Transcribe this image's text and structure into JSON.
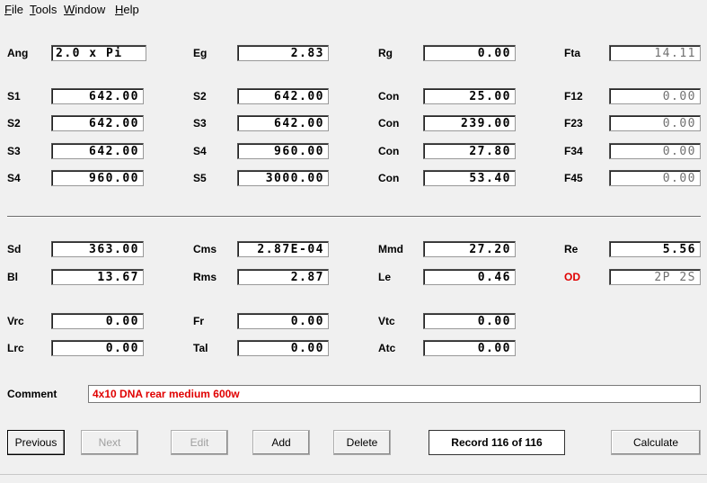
{
  "menu": [
    {
      "pre": "",
      "ul": "F",
      "post": "ile"
    },
    {
      "pre": "",
      "ul": "T",
      "post": "ools"
    },
    {
      "pre": "",
      "ul": "W",
      "post": "indow"
    },
    {
      "pre": "",
      "ul": "H",
      "post": "elp"
    }
  ],
  "params": {
    "ang": {
      "label": "Ang",
      "value": "2.0 x Pi"
    },
    "eg": {
      "label": "Eg",
      "value": "2.83"
    },
    "rg": {
      "label": "Rg",
      "value": "0.00"
    },
    "fta": {
      "label": "Fta",
      "value": "14.11"
    }
  },
  "stages": [
    {
      "a_label": "S1",
      "a": "642.00",
      "b_label": "S2",
      "b": "642.00",
      "c_label": "Con",
      "c": "25.00",
      "f_label": "F12",
      "f": "0.00"
    },
    {
      "a_label": "S2",
      "a": "642.00",
      "b_label": "S3",
      "b": "642.00",
      "c_label": "Con",
      "c": "239.00",
      "f_label": "F23",
      "f": "0.00"
    },
    {
      "a_label": "S3",
      "a": "642.00",
      "b_label": "S4",
      "b": "960.00",
      "c_label": "Con",
      "c": "27.80",
      "f_label": "F34",
      "f": "0.00"
    },
    {
      "a_label": "S4",
      "a": "960.00",
      "b_label": "S5",
      "b": "3000.00",
      "c_label": "Con",
      "c": "53.40",
      "f_label": "F45",
      "f": "0.00"
    }
  ],
  "driver": {
    "sd": {
      "label": "Sd",
      "value": "363.00"
    },
    "cms": {
      "label": "Cms",
      "value": "2.87E-04"
    },
    "mmd": {
      "label": "Mmd",
      "value": "27.20"
    },
    "re": {
      "label": "Re",
      "value": "5.56"
    },
    "bl": {
      "label": "Bl",
      "value": "13.67"
    },
    "rms": {
      "label": "Rms",
      "value": "2.87"
    },
    "le": {
      "label": "Le",
      "value": "0.46"
    },
    "od": {
      "label": "OD",
      "value": "2P 2S"
    }
  },
  "vent": {
    "vrc": {
      "label": "Vrc",
      "value": "0.00"
    },
    "fr": {
      "label": "Fr",
      "value": "0.00"
    },
    "vtc": {
      "label": "Vtc",
      "value": "0.00"
    },
    "lrc": {
      "label": "Lrc",
      "value": "0.00"
    },
    "tal": {
      "label": "Tal",
      "value": "0.00"
    },
    "atc": {
      "label": "Atc",
      "value": "0.00"
    }
  },
  "comment": {
    "label": "Comment",
    "value": "4x10 DNA rear medium 600w"
  },
  "buttons": {
    "previous": "Previous",
    "next": "Next",
    "edit": "Edit",
    "add": "Add",
    "delete": "Delete",
    "calculate": "Calculate"
  },
  "record": "Record 116 of 116",
  "colors": {
    "od_label": "#e00000",
    "comment_text": "#e00000"
  }
}
